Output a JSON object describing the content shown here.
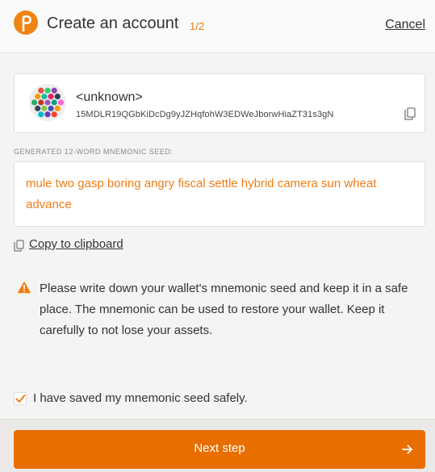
{
  "header": {
    "title": "Create an account",
    "step": "1/2",
    "cancel_label": "Cancel"
  },
  "account": {
    "name": "<unknown>",
    "address": "15MDLR19QGbKiDcDg9yJZHqfohW3EDWeJborwHiaZT31s3gN",
    "identicon_colors": [
      "#e74c3c",
      "#2ecc71",
      "#8e44ad",
      "#f39c12",
      "#1abc9c",
      "#e91e63",
      "#2c3e50",
      "#27ae60",
      "#c0392b",
      "#9b59b6",
      "#16a085",
      "#ff66cc",
      "#34495e",
      "#8bc34a",
      "#3f51b5",
      "#ff9800",
      "#00bcd4",
      "#673ab7",
      "#f44336"
    ]
  },
  "seed": {
    "label": "GENERATED 12-WORD MNEMONIC SEED:",
    "phrase": "mule two gasp boring angry fiscal settle hybrid camera sun wheat advance"
  },
  "clipboard": {
    "label": "Copy to clipboard"
  },
  "warning": {
    "text": "Please write down your wallet's mnemonic seed and keep it in a safe place. The mnemonic can be used to restore your wallet. Keep it carefully to not lose your assets."
  },
  "confirm": {
    "label": "I have saved my mnemonic seed safely.",
    "checked": true
  },
  "footer": {
    "next_label": "Next step"
  },
  "colors": {
    "accent": "#e86e00",
    "seed_text": "#ef7d14"
  }
}
